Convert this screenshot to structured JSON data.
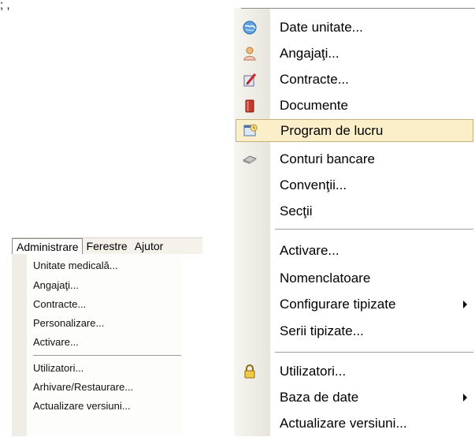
{
  "caption": "; ,",
  "small_menu": {
    "menubar": [
      "Administrare",
      "Ferestre",
      "Ajutor"
    ],
    "items": [
      "Unitate medicală...",
      "Angajaţi...",
      "Contracte...",
      "Personalizare...",
      "Activare...",
      "Utilizatori...",
      "Arhivare/Restaurare...",
      "Actualizare versiuni..."
    ]
  },
  "big_menu": {
    "items": [
      {
        "label": "Date unitate...",
        "icon": "globe-icon"
      },
      {
        "label": "Angajaţi...",
        "icon": "person-icon"
      },
      {
        "label": "Contracte...",
        "icon": "contract-pen-icon"
      },
      {
        "label": "Documente",
        "icon": "book-icon"
      },
      {
        "label": "Program de lucru",
        "icon": "schedule-icon"
      },
      {
        "label": "Conturi bancare",
        "icon": "bank-card-icon"
      },
      {
        "label": "Convenţii...",
        "icon": ""
      },
      {
        "label": "Secţii",
        "icon": ""
      },
      {
        "label": "Activare...",
        "icon": ""
      },
      {
        "label": "Nomenclatoare",
        "icon": ""
      },
      {
        "label": "Configurare tipizate",
        "icon": ""
      },
      {
        "label": "Serii tipizate...",
        "icon": ""
      },
      {
        "label": "Utilizatori...",
        "icon": "lock-icon"
      },
      {
        "label": "Baza de date",
        "icon": ""
      },
      {
        "label": "Actualizare versiuni...",
        "icon": ""
      }
    ],
    "highlighted": "Program de lucru"
  },
  "colors": {
    "highlight_bg": "#fbefc9",
    "highlight_border": "#c8b07a",
    "menubar_bg": "#f4f2ea"
  }
}
